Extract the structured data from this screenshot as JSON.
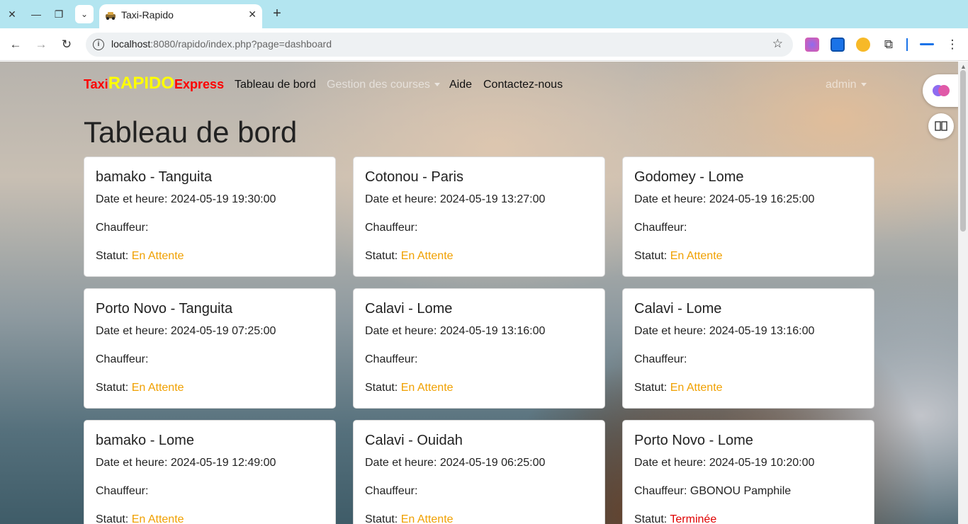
{
  "browser": {
    "tab_title": "Taxi-Rapido",
    "url_host": "localhost",
    "url_rest": ":8080/rapido/index.php?page=dashboard",
    "icons": [
      "close-icon",
      "minimize-icon",
      "restore-icon",
      "tab-dropdown-icon",
      "new-tab-icon",
      "back-icon",
      "forward-icon",
      "reload-icon",
      "info-icon",
      "star-icon",
      "extension-brain-icon",
      "extension-download-icon",
      "extension-orange-icon",
      "puzzle-icon",
      "menu-icon"
    ]
  },
  "navbar": {
    "brand_taxi": "Taxi",
    "brand_rapido": "RAPIDO",
    "brand_express": "Express",
    "links": {
      "dashboard": "Tableau de bord",
      "courses": "Gestion des courses",
      "help": "Aide",
      "contact": "Contactez-nous"
    },
    "user": "admin"
  },
  "main": {
    "title": "Tableau de bord",
    "labels": {
      "date": "Date et heure: ",
      "driver": "Chauffeur:",
      "status": "Statut: "
    },
    "cards": [
      {
        "route": "bamako - Tanguita",
        "datetime": "2024-05-19 19:30:00",
        "driver": "",
        "status": "En Attente"
      },
      {
        "route": "Cotonou - Paris",
        "datetime": "2024-05-19 13:27:00",
        "driver": "",
        "status": "En Attente"
      },
      {
        "route": "Godomey - Lome",
        "datetime": "2024-05-19 16:25:00",
        "driver": "",
        "status": "En Attente"
      },
      {
        "route": "Porto Novo - Tanguita",
        "datetime": "2024-05-19 07:25:00",
        "driver": "",
        "status": "En Attente"
      },
      {
        "route": "Calavi - Lome",
        "datetime": "2024-05-19 13:16:00",
        "driver": "",
        "status": "En Attente"
      },
      {
        "route": "Calavi - Lome",
        "datetime": "2024-05-19 13:16:00",
        "driver": "",
        "status": "En Attente"
      },
      {
        "route": "bamako - Lome",
        "datetime": "2024-05-19 12:49:00",
        "driver": "",
        "status": "En Attente"
      },
      {
        "route": "Calavi - Ouidah",
        "datetime": "2024-05-19 06:25:00",
        "driver": "",
        "status": "En Attente"
      },
      {
        "route": "Porto Novo - Lome",
        "datetime": "2024-05-19 10:20:00",
        "driver": "GBONOU Pamphile",
        "status": "Terminée"
      }
    ]
  },
  "colors": {
    "status_waiting": "#f0a000",
    "status_done": "#e00000",
    "brand_red": "#ff0000",
    "brand_yellow": "#ffff00"
  }
}
